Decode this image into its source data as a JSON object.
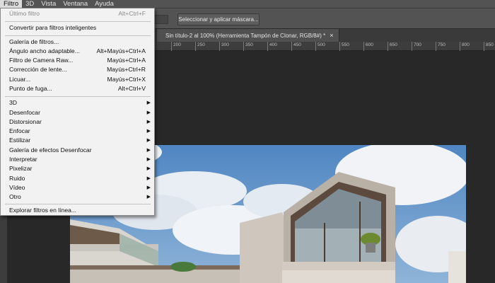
{
  "menubar": {
    "items": [
      "Filtro",
      "3D",
      "Vista",
      "Ventana",
      "Ayuda"
    ]
  },
  "options_bar": {
    "mask_button": "Seleccionar y aplicar máscara..."
  },
  "document_tab": {
    "title": "Sin título-2 al 100% (Herramienta Tampón de Clonar, RGB/8#) *",
    "close": "×"
  },
  "ruler": {
    "labels": [
      "200",
      "250",
      "300",
      "350",
      "400",
      "450",
      "500",
      "550",
      "600",
      "650",
      "700",
      "750",
      "800",
      "850"
    ]
  },
  "filter_menu": {
    "last_filter": {
      "label": "Último filtro",
      "shortcut": "Alt+Ctrl+F"
    },
    "smart_filters": {
      "label": "Convertir para filtros inteligentes"
    },
    "gallery": {
      "label": "Galería de filtros..."
    },
    "adaptive_wide": {
      "label": "Ángulo ancho adaptable...",
      "shortcut": "Alt+Mayús+Ctrl+A"
    },
    "camera_raw": {
      "label": "Filtro de Camera Raw...",
      "shortcut": "Mayús+Ctrl+A"
    },
    "lens_correction": {
      "label": "Corrección de lente...",
      "shortcut": "Mayús+Ctrl+R"
    },
    "liquify": {
      "label": "Licuar...",
      "shortcut": "Mayús+Ctrl+X"
    },
    "vanishing_point": {
      "label": "Punto de fuga...",
      "shortcut": "Alt+Ctrl+V"
    },
    "submenus": [
      "3D",
      "Desenfocar",
      "Distorsionar",
      "Enfocar",
      "Estilizar",
      "Galería de efectos Desenfocar",
      "Interpretar",
      "Pixelizar",
      "Ruido",
      "Vídeo",
      "Otro"
    ],
    "browse_online": {
      "label": "Explorar filtros en línea..."
    },
    "arrow_glyph": "▶"
  }
}
